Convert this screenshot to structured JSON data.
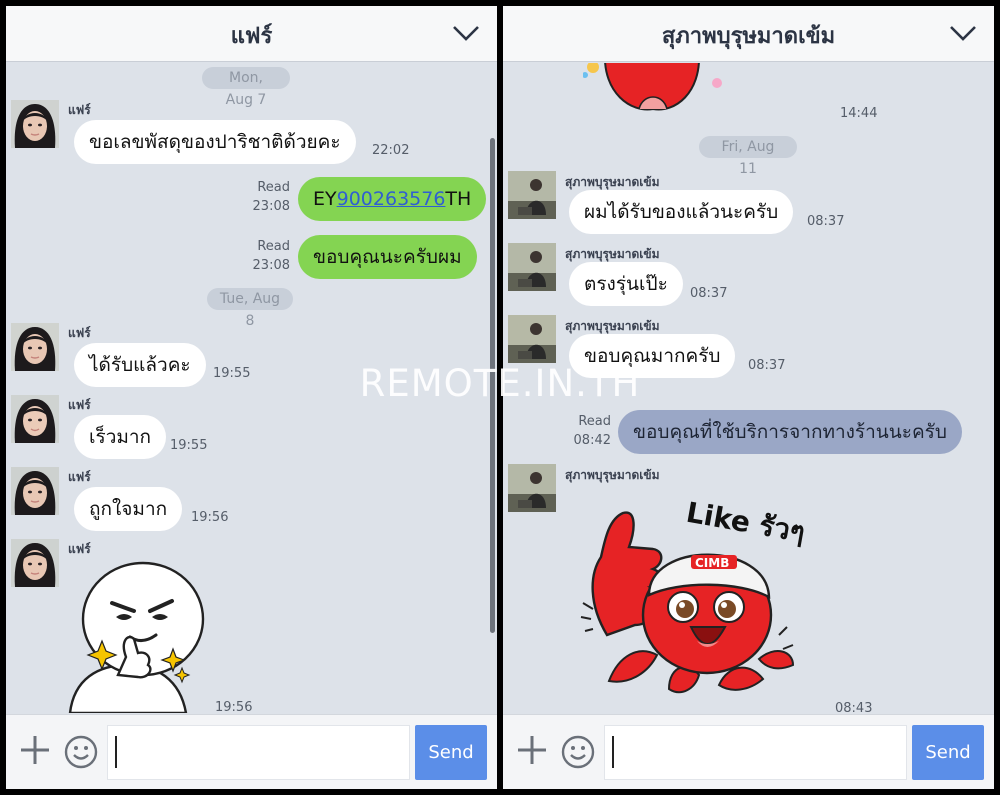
{
  "left": {
    "header_title": "แฟร์",
    "dates": [
      "Mon, Aug 7",
      "Tue, Aug 8"
    ],
    "sender_name": "แฟร์",
    "messages": [
      {
        "text": "ขอเลขพัสดุของปาริชาติด้วยคะ",
        "time": "22:02"
      },
      {
        "text_prefix": "EY",
        "text_link": "900263576",
        "text_suffix": "TH",
        "read": "Read",
        "time": "23:08"
      },
      {
        "text": "ขอบคุณนะครับผม",
        "read": "Read",
        "time": "23:08"
      },
      {
        "text": "ได้รับแล้วคะ",
        "time": "19:55"
      },
      {
        "text": "เร็วมาก",
        "time": "19:55"
      },
      {
        "text": "ถูกใจมาก",
        "time": "19:56"
      },
      {
        "sticker": "thumbs-up-man",
        "time": "19:56"
      }
    ],
    "send_label": "Send"
  },
  "right": {
    "header_title": "สุภาพบุรุษมาดเข้ม",
    "top_time": "14:44",
    "date": "Fri, Aug 11",
    "sender_name": "สุภาพบุรุษมาดเข้ม",
    "messages": [
      {
        "text": "ผมได้รับของแล้วนะครับ",
        "time": "08:37"
      },
      {
        "text": "ตรงรุ่นเป๊ะ",
        "time": "08:37"
      },
      {
        "text": "ขอบคุณมากครับ",
        "time": "08:37"
      },
      {
        "text": "ขอบคุณที่ใช้บริการจากทางร้านนะครับ",
        "read": "Read",
        "time": "08:42"
      },
      {
        "sticker": "octopus-like",
        "sticker_text": "Like รัวๆ",
        "brand": "CIMB",
        "time": "08:43"
      }
    ],
    "send_label": "Send"
  },
  "watermark": "REMOTE.IN.TH",
  "colors": {
    "chat_bg": "#dde2e9",
    "outgoing_green": "#84d452",
    "outgoing_blue": "#9aa7c6",
    "send_button": "#5b8ee8",
    "date_pill": "#c8cfd9"
  }
}
